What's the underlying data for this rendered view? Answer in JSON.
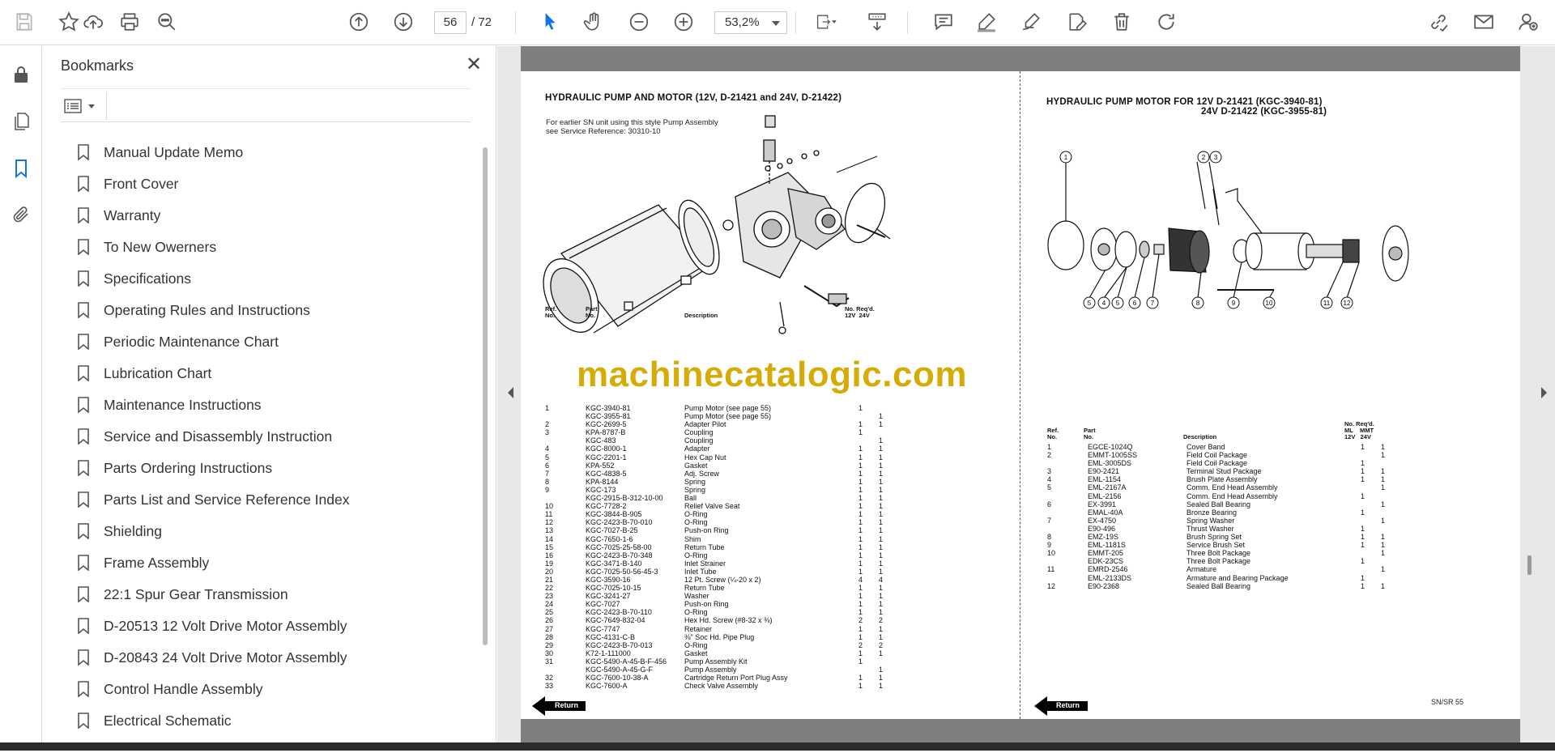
{
  "toolbar": {
    "page_current": "56",
    "page_total": "/ 72",
    "zoom": "53,2%"
  },
  "panel": {
    "title": "Bookmarks",
    "items": [
      {
        "label": "Manual Update Memo"
      },
      {
        "label": "Front Cover"
      },
      {
        "label": "Warranty"
      },
      {
        "label": "To New Owerners"
      },
      {
        "label": "Specifications"
      },
      {
        "label": "Operating Rules and Instructions"
      },
      {
        "label": "Periodic Maintenance Chart"
      },
      {
        "label": "Lubrication Chart"
      },
      {
        "label": "Maintenance Instructions"
      },
      {
        "label": "Service and Disassembly Instruction"
      },
      {
        "label": "Parts Ordering Instructions"
      },
      {
        "label": "Parts List and Service Reference Index"
      },
      {
        "label": "Shielding"
      },
      {
        "label": "Frame Assembly"
      },
      {
        "label": "22:1 Spur Gear Transmission"
      },
      {
        "label": "D-20513 12 Volt Drive Motor Assembly"
      },
      {
        "label": "D-20843 24 Volt Drive Motor Assembly"
      },
      {
        "label": "Control Handle Assembly"
      },
      {
        "label": "Electrical Schematic"
      }
    ]
  },
  "left_page": {
    "title": "HYDRAULIC PUMP AND MOTOR (12V, D-21421 and 24V, D-21422)",
    "note_line1": "For earlier SN unit using this style Pump Assembly",
    "note_line2": "see Service Reference: 30310-10",
    "header_ref": "Ref.\nNo.",
    "header_part": "Part\nNo.",
    "header_desc": "Description",
    "header_qty": "No. Req'd.\n12V  24V",
    "rows": [
      [
        "1",
        "KGC-3940-81",
        "Pump Motor (see page 55)",
        "1",
        ""
      ],
      [
        "",
        "KGC-3955-81",
        "Pump Motor (see page 55)",
        "",
        "1"
      ],
      [
        "2",
        "KGC-2699-5",
        "Adapter Pilot",
        "1",
        "1"
      ],
      [
        "3",
        "KPA-8787-B",
        "Coupling",
        "1",
        ""
      ],
      [
        "",
        "KGC-483",
        "Coupling",
        "",
        "1"
      ],
      [
        "4",
        "KGC-8000-1",
        "Adapter",
        "1",
        "1"
      ],
      [
        "5",
        "KGC-2201-1",
        "Hex Cap Nut",
        "1",
        "1"
      ],
      [
        "6",
        "KPA-552",
        "Gasket",
        "1",
        "1"
      ],
      [
        "7",
        "KGC-4838-5",
        "Adj. Screw",
        "1",
        "1"
      ],
      [
        "8",
        "KPA-8144",
        "Spring",
        "1",
        "1"
      ],
      [
        "9",
        "KGC-173",
        "Spring",
        "1",
        "1"
      ],
      [
        "",
        "KGC-2915-B-312-10-00",
        "Ball",
        "1",
        "1"
      ],
      [
        "10",
        "KGC-7728-2",
        "Relief Valve Seat",
        "1",
        "1"
      ],
      [
        "11",
        "KGC-3844-B-905",
        "O-Ring",
        "1",
        "1"
      ],
      [
        "12",
        "KGC-2423-B-70-010",
        "O-Ring",
        "1",
        "1"
      ],
      [
        "13",
        "KGC-7027-B-25",
        "Push-on Ring",
        "1",
        "1"
      ],
      [
        "14",
        "KGC-7650-1-6",
        "Shim",
        "1",
        "1"
      ],
      [
        "15",
        "KGC-7025-25-58-00",
        "Return Tube",
        "1",
        "1"
      ],
      [
        "16",
        "KGC-2423-B-70-348",
        "O-Ring",
        "1",
        "1"
      ],
      [
        "19",
        "KGC-3471-B-140",
        "Inlet Strainer",
        "1",
        "1"
      ],
      [
        "20",
        "KGC-7025-50-56-45-3",
        "Inlet Tube",
        "1",
        "1"
      ],
      [
        "21",
        "KGC-3590-16",
        "12 Pt. Screw (¼-20 x 2)",
        "4",
        "4"
      ],
      [
        "22",
        "KGC-7025-10-15",
        "Return Tube",
        "1",
        "1"
      ],
      [
        "23",
        "KGC-3241-27",
        "Washer",
        "1",
        "1"
      ],
      [
        "24",
        "KGC-7027",
        "Push-on Ring",
        "1",
        "1"
      ],
      [
        "25",
        "KGC-2423-B-70-110",
        "O-Ring",
        "1",
        "1"
      ],
      [
        "26",
        "KGC-7649-832-04",
        "Hex Hd. Screw (#8-32 x ⅜)",
        "2",
        "2"
      ],
      [
        "27",
        "KGC-7747",
        "Retainer",
        "1",
        "1"
      ],
      [
        "28",
        "KGC-4131-C-B",
        "⅜\" Soc Hd. Pipe Plug",
        "1",
        "1"
      ],
      [
        "29",
        "KGC-2423-B-70-013",
        "O-Ring",
        "2",
        "2"
      ],
      [
        "30",
        "K72-1-111000",
        "Gasket",
        "1",
        "1"
      ],
      [
        "31",
        "KGC-5490-A-45-B-F-456",
        "Pump Assembly Kit",
        "1",
        ""
      ],
      [
        "",
        "KGC-5490-A-45-G-F",
        "Pump Assembly",
        "",
        "1"
      ],
      [
        "32",
        "KGC-7600-10-38-A",
        "Cartridge Return Port Plug Assy",
        "1",
        "1"
      ],
      [
        "33",
        "KGC-7600-A",
        "Check Valve Assembly",
        "1",
        "1"
      ]
    ],
    "return_label": "Return"
  },
  "right_page": {
    "title_line1": "HYDRAULIC PUMP MOTOR FOR 12V D-21421 (KGC-3940-81)",
    "title_line2": "24V D-21422 (KGC-3955-81)",
    "header_ref": "Ref.\nNo.",
    "header_part": "Part\nNo.",
    "header_desc": "Description",
    "header_qty": "No. Req'd.\nML    MMT\n12V   24V",
    "callouts_top": [
      "1",
      "2",
      "3"
    ],
    "callouts_bottom": [
      "5",
      "4",
      "5",
      "6",
      "7",
      "8",
      "9",
      "10",
      "11",
      "12"
    ],
    "rows": [
      [
        "1",
        "EGCE-1024Q",
        "Cover Band",
        "1",
        "1"
      ],
      [
        "2",
        "EMMT-1005SS",
        "Field Coil Package",
        "",
        "1"
      ],
      [
        "",
        "EML-3005DS",
        "Field Coil Package",
        "1",
        ""
      ],
      [
        "3",
        "E90-2421",
        "Terminal Stud Package",
        "1",
        "1"
      ],
      [
        "4",
        "EML-1154",
        "Brush Plate Assembly",
        "1",
        "1"
      ],
      [
        "5",
        "EML-2167A",
        "Comm. End Head Assembly",
        "",
        "1"
      ],
      [
        "",
        "EML-2156",
        "Comm. End Head Assembly",
        "1",
        ""
      ],
      [
        "6",
        "EX-3991",
        "Sealed Ball Bearing",
        "",
        "1"
      ],
      [
        "",
        "EMAL-40A",
        "Bronze Bearing",
        "1",
        ""
      ],
      [
        "7",
        "EX-4750",
        "Spring Washer",
        "",
        "1"
      ],
      [
        "",
        "E90-496",
        "Thrust Washer",
        "1",
        ""
      ],
      [
        "8",
        "EMZ-19S",
        "Brush Spring Set",
        "1",
        "1"
      ],
      [
        "9",
        "EML-1181S",
        "Service Brush Set",
        "1",
        "1"
      ],
      [
        "10",
        "EMMT-205",
        "Three Bolt Package",
        "",
        "1"
      ],
      [
        "",
        "EDK-23CS",
        "Three Bolt Package",
        "1",
        ""
      ],
      [
        "11",
        "EMRD-2546",
        "Armature",
        "",
        "1"
      ],
      [
        "",
        "EML-2133DS",
        "Armature and Bearing Package",
        "1",
        ""
      ],
      [
        "12",
        "E90-2368",
        "Sealed Ball Bearing",
        "1",
        "1"
      ]
    ],
    "return_label": "Return",
    "footer": "SN/SR 55"
  },
  "watermark": "machinecatalogic.com",
  "colors": {
    "accent": "#1473e6",
    "watermark": "#d4aa00",
    "page_frame": "#7f7f7f"
  }
}
